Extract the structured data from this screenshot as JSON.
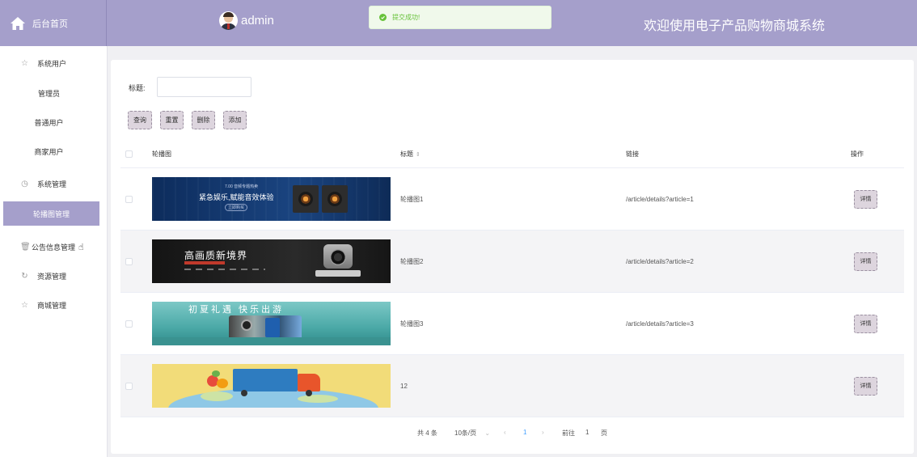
{
  "header": {
    "home_label": "后台首页",
    "username": "admin",
    "toast": "提交成功!",
    "title": "欢迎使用电子产品购物商城系统"
  },
  "sidebar": {
    "items": [
      {
        "label": "系统用户",
        "icon": "star-icon"
      },
      {
        "label": "管理员"
      },
      {
        "label": "普通用户"
      },
      {
        "label": "商家用户"
      },
      {
        "label": "系统管理",
        "icon": "clock-icon"
      },
      {
        "label": "轮播图管理",
        "active": true
      },
      {
        "label": "公告信息管理",
        "icon": "trash-icon"
      },
      {
        "label": "资源管理",
        "icon": "refresh-icon"
      },
      {
        "label": "商城管理",
        "icon": "star-icon"
      }
    ]
  },
  "search": {
    "label": "标题:",
    "value": "",
    "placeholder": ""
  },
  "buttons": {
    "query": "查询",
    "reset": "重置",
    "delete": "删除",
    "add": "添加"
  },
  "table": {
    "columns": [
      "轮播图",
      "标题",
      "链接",
      "操作"
    ],
    "sort_icon": "⇕",
    "rows": [
      {
        "title": "轮播图1",
        "link": "/article/details?article=1",
        "action": "详情",
        "banner_text": "紧急娱乐,赋能音效体验",
        "banner_small": "7.00 音频专题热卖",
        "banner_tag": "立即购买"
      },
      {
        "title": "轮播图2",
        "link": "/article/details?article=2",
        "action": "详情",
        "banner_text": "高画质新境界",
        "banner_small": "",
        "banner_tag": ""
      },
      {
        "title": "轮播图3",
        "link": "/article/details?article=3",
        "action": "详情",
        "banner_text": "初夏礼遇 快乐出游",
        "banner_small": "",
        "banner_tag": ""
      },
      {
        "title": "12",
        "link": "",
        "action": "详情",
        "banner_text": "",
        "banner_small": "",
        "banner_tag": ""
      }
    ]
  },
  "pagination": {
    "total": "共 4 条",
    "page_size": "10条/页",
    "current_page": "1",
    "goto_label": "前往",
    "goto_value": "1",
    "page_suffix": "页"
  },
  "colors": {
    "accent": "#a59fcb",
    "button_bg": "#ddd5de",
    "toast_green": "#67c23a"
  }
}
